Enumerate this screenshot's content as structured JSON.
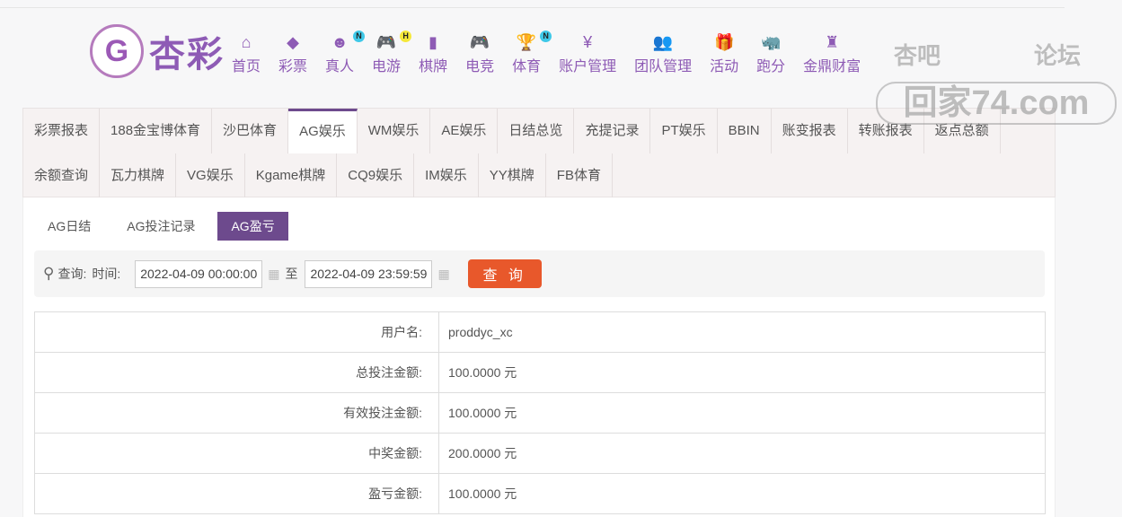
{
  "brand": {
    "logo_text": "杏彩",
    "logo_mark": "G"
  },
  "nav": [
    {
      "label": "首页",
      "icon": "home-icon",
      "glyph": "⌂"
    },
    {
      "label": "彩票",
      "icon": "ticket-icon",
      "glyph": "◆"
    },
    {
      "label": "真人",
      "icon": "live-dealer-icon",
      "glyph": "☻",
      "badge": "N",
      "badge_color": "#3ec8e8"
    },
    {
      "label": "电游",
      "icon": "gamepad-icon",
      "glyph": "🎮",
      "badge": "H",
      "badge_color": "#f5e83a"
    },
    {
      "label": "棋牌",
      "icon": "cards-icon",
      "glyph": "▮"
    },
    {
      "label": "电竞",
      "icon": "esports-icon",
      "glyph": "🎮"
    },
    {
      "label": "体育",
      "icon": "trophy-icon",
      "glyph": "🏆",
      "badge": "N",
      "badge_color": "#3ec8e8"
    },
    {
      "label": "账户管理",
      "icon": "yen-icon",
      "glyph": "¥"
    },
    {
      "label": "团队管理",
      "icon": "team-icon",
      "glyph": "👥"
    },
    {
      "label": "活动",
      "icon": "gift-icon",
      "glyph": "🎁"
    },
    {
      "label": "跑分",
      "icon": "rhino-icon",
      "glyph": "🦏"
    },
    {
      "label": "金鼎财富",
      "icon": "cauldron-icon",
      "glyph": "♜"
    }
  ],
  "tabs_row1": [
    "彩票报表",
    "188金宝博体育",
    "沙巴体育",
    "AG娱乐",
    "WM娱乐",
    "AE娱乐",
    "日结总览",
    "充提记录",
    "PT娱乐",
    "BBIN",
    "账变报表",
    "转账报表",
    "返点总额"
  ],
  "tabs_row2": [
    "余额查询",
    "瓦力棋牌",
    "VG娱乐",
    "Kgame棋牌",
    "CQ9娱乐",
    "IM娱乐",
    "YY棋牌",
    "FB体育"
  ],
  "active_tab": "AG娱乐",
  "subtabs": [
    "AG日结",
    "AG投注记录",
    "AG盈亏"
  ],
  "active_subtab": "AG盈亏",
  "query": {
    "label": "查询:",
    "time_label": "时间:",
    "start": "2022-04-09 00:00:00",
    "to": "至",
    "end": "2022-04-09 23:59:59",
    "button": "查 询"
  },
  "rows": [
    {
      "label": "用户名:",
      "value": "proddyc_xc"
    },
    {
      "label": "总投注金额:",
      "value": "100.0000 元"
    },
    {
      "label": "有效投注金额:",
      "value": "100.0000 元"
    },
    {
      "label": "中奖金额:",
      "value": "200.0000 元"
    },
    {
      "label": "盈亏金额:",
      "value": "100.0000 元"
    }
  ],
  "watermark": {
    "line1a": "杏吧",
    "line1b": "论坛",
    "line2": "回家74.com"
  },
  "colors": {
    "accent": "#6d4a8d",
    "nav": "#8e5bb5",
    "button": "#e8582b"
  }
}
